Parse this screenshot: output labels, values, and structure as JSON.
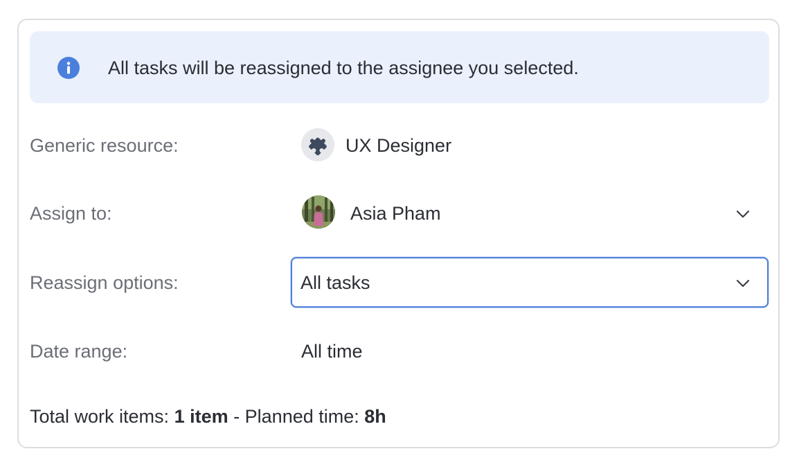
{
  "banner": {
    "icon": "info-icon",
    "message": "All tasks will be reassigned to the assignee you selected.",
    "accent": "#4a7fde",
    "background": "#eaf1fc"
  },
  "generic_resource": {
    "label": "Generic resource:",
    "icon": "puzzle-icon",
    "value": "UX Designer"
  },
  "assign_to": {
    "label": "Assign to:",
    "avatar": "user-avatar",
    "value": "Asia Pham",
    "dropdown_icon": "chevron-down-icon"
  },
  "reassign_options": {
    "label": "Reassign options:",
    "selected": "All tasks",
    "dropdown_icon": "chevron-down-icon",
    "focus_color": "#4f7fd8"
  },
  "date_range": {
    "label": "Date range:",
    "value": "All time"
  },
  "summary": {
    "items_label": "Total work items:",
    "items_value": "1 item",
    "separator": "-",
    "time_label": "Planned time:",
    "time_value": "8h"
  }
}
